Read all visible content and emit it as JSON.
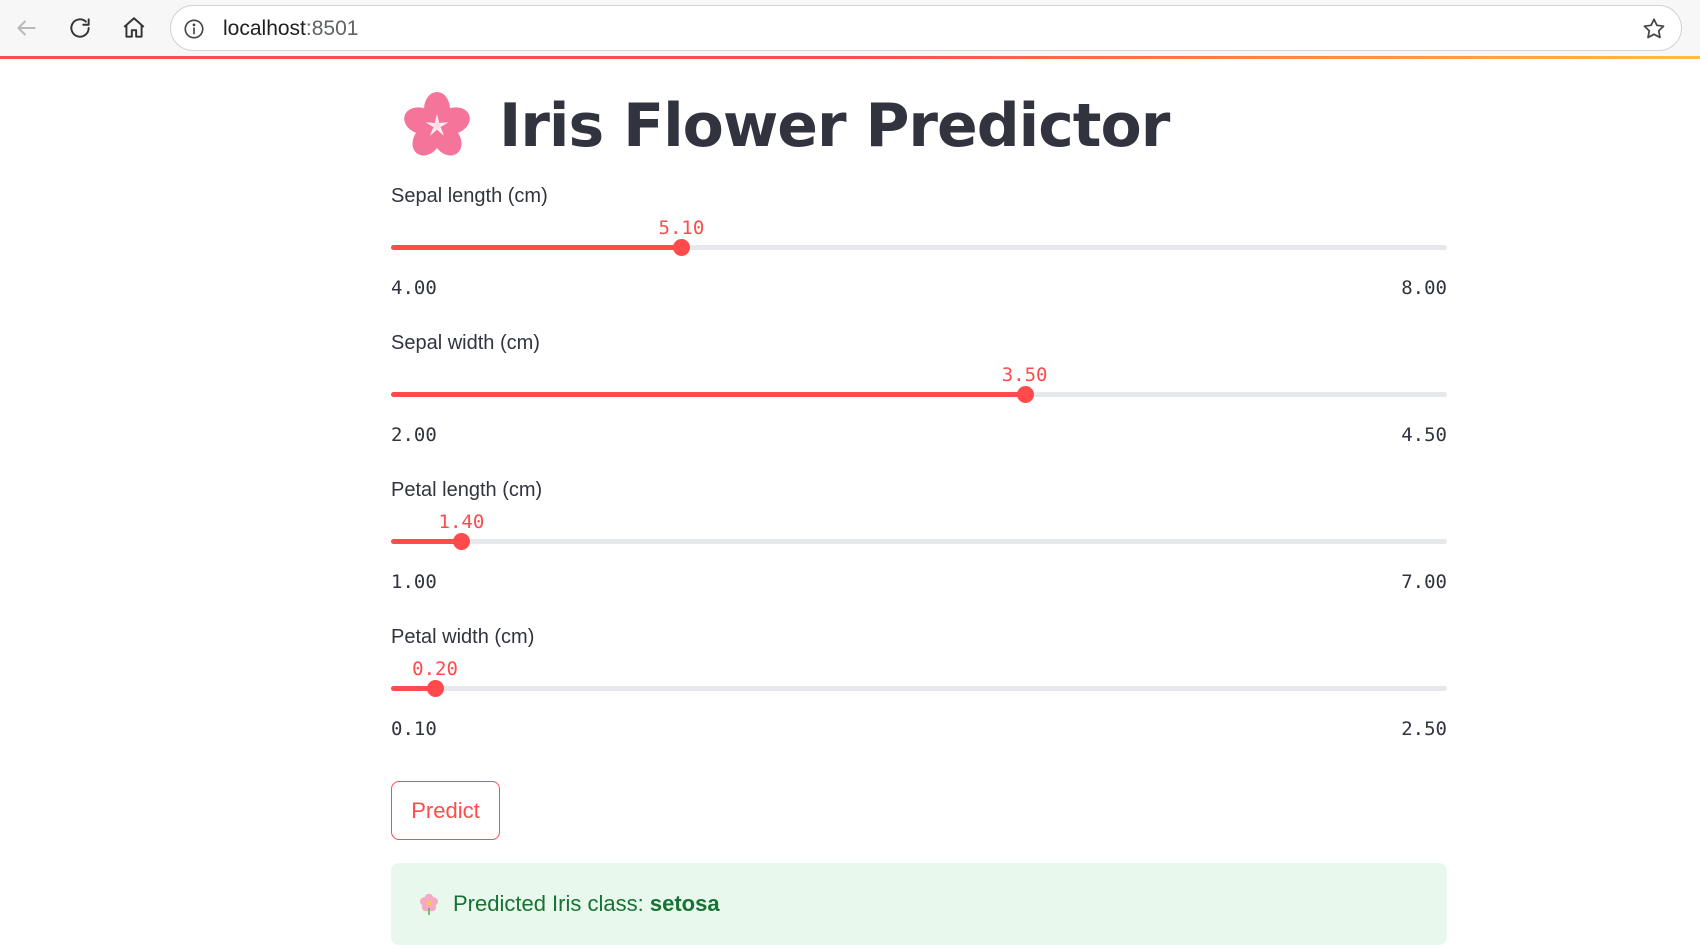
{
  "browser": {
    "url_host": "localhost",
    "url_port": ":8501"
  },
  "page": {
    "title": "Iris Flower Predictor",
    "title_icon": "cherry-blossom-icon"
  },
  "sliders": [
    {
      "label": "Sepal length (cm)",
      "value": "5.10",
      "min": "4.00",
      "max": "8.00",
      "fraction": 0.275
    },
    {
      "label": "Sepal width (cm)",
      "value": "3.50",
      "min": "2.00",
      "max": "4.50",
      "fraction": 0.6
    },
    {
      "label": "Petal length (cm)",
      "value": "1.40",
      "min": "1.00",
      "max": "7.00",
      "fraction": 0.0667
    },
    {
      "label": "Petal width (cm)",
      "value": "0.20",
      "min": "0.10",
      "max": "2.50",
      "fraction": 0.0417
    }
  ],
  "predict_button": {
    "label": "Predict"
  },
  "result": {
    "icon": "flower-icon",
    "prefix": "Predicted Iris class: ",
    "class_name": "setosa"
  },
  "colors": {
    "accent": "#ff4b4b",
    "success_bg": "#e8f8ec",
    "success_text": "#177233",
    "text": "#31333f"
  }
}
